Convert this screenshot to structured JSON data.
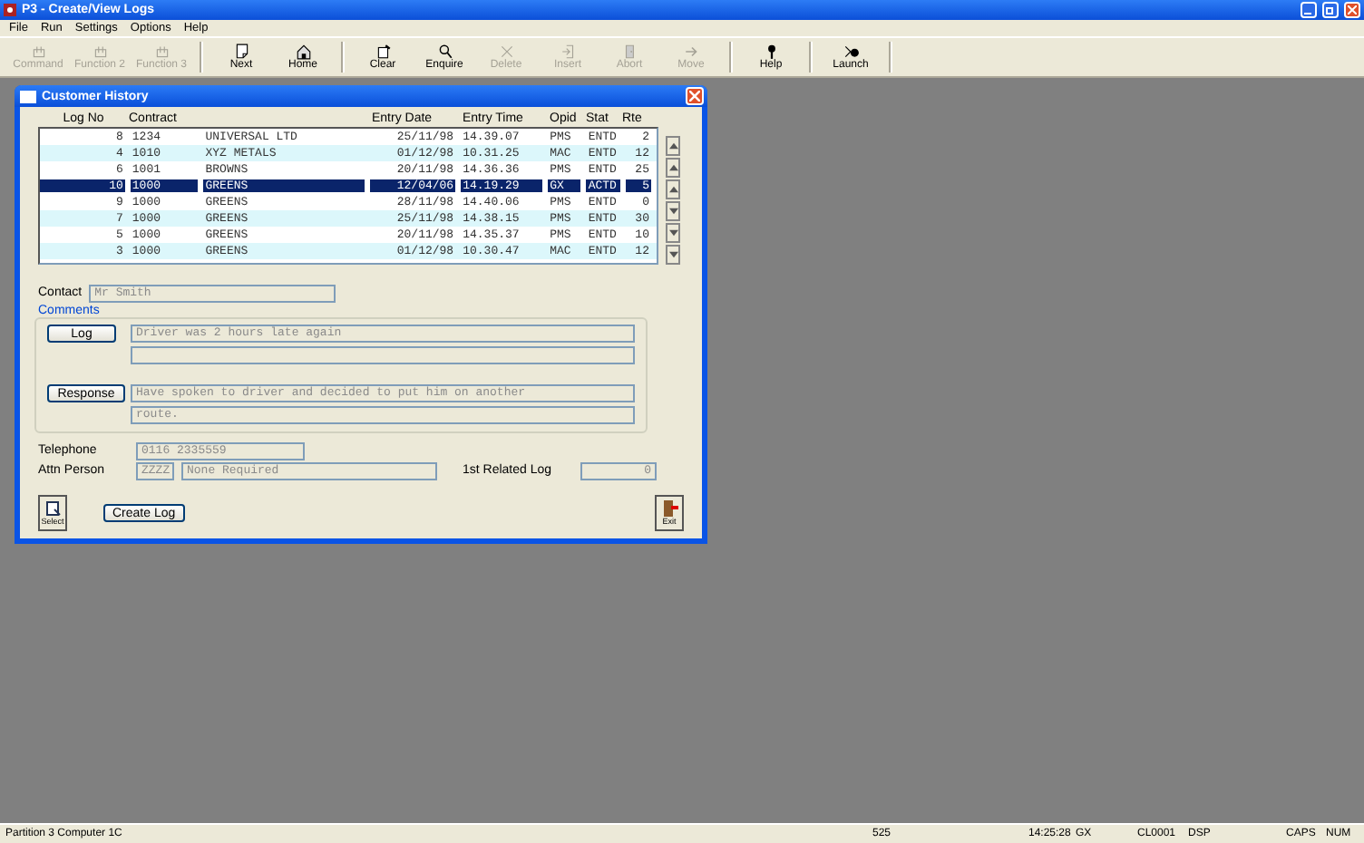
{
  "window": {
    "title": "P3 - Create/View Logs"
  },
  "menu": [
    "File",
    "Run",
    "Settings",
    "Options",
    "Help"
  ],
  "toolbar": [
    {
      "label": "Command",
      "disabled": true
    },
    {
      "label": "Function 2",
      "disabled": true
    },
    {
      "label": "Function 3",
      "disabled": true
    },
    {
      "label": "Next",
      "disabled": false
    },
    {
      "label": "Home",
      "disabled": false
    },
    {
      "label": "Clear",
      "disabled": false
    },
    {
      "label": "Enquire",
      "disabled": false
    },
    {
      "label": "Delete",
      "disabled": true
    },
    {
      "label": "Insert",
      "disabled": true
    },
    {
      "label": "Abort",
      "disabled": true
    },
    {
      "label": "Move",
      "disabled": true
    },
    {
      "label": "Help",
      "disabled": false
    },
    {
      "label": "Launch",
      "disabled": false
    }
  ],
  "dialog": {
    "title": "Customer History",
    "table": {
      "columns": [
        "Log No",
        "Contract",
        null,
        "Entry Date",
        "Entry Time",
        "Opid",
        "Stat",
        "Rte"
      ],
      "rows": [
        {
          "cells": [
            "8",
            "1234",
            "UNIVERSAL LTD",
            "25/11/98",
            "14.39.07",
            "PMS",
            "ENTD",
            "2"
          ],
          "selected": false
        },
        {
          "cells": [
            "4",
            "1010",
            "XYZ METALS",
            "01/12/98",
            "10.31.25",
            "MAC",
            "ENTD",
            "12"
          ],
          "selected": false
        },
        {
          "cells": [
            "6",
            "1001",
            "BROWNS",
            "20/11/98",
            "14.36.36",
            "PMS",
            "ENTD",
            "25"
          ],
          "selected": false
        },
        {
          "cells": [
            "10",
            "1000",
            "GREENS",
            "12/04/06",
            "14.19.29",
            "GX",
            "ACTD",
            "5"
          ],
          "selected": true
        },
        {
          "cells": [
            "9",
            "1000",
            "GREENS",
            "28/11/98",
            "14.40.06",
            "PMS",
            "ENTD",
            "0"
          ],
          "selected": false
        },
        {
          "cells": [
            "7",
            "1000",
            "GREENS",
            "25/11/98",
            "14.38.15",
            "PMS",
            "ENTD",
            "30"
          ],
          "selected": false
        },
        {
          "cells": [
            "5",
            "1000",
            "GREENS",
            "20/11/98",
            "14.35.37",
            "PMS",
            "ENTD",
            "10"
          ],
          "selected": false
        },
        {
          "cells": [
            "3",
            "1000",
            "GREENS",
            "01/12/98",
            "10.30.47",
            "MAC",
            "ENTD",
            "12"
          ],
          "selected": false
        }
      ]
    },
    "contact": {
      "label": "Contact",
      "value": "Mr Smith"
    },
    "comments": {
      "title": "Comments",
      "log_button": "Log",
      "log_lines": [
        "Driver was 2 hours late again"
      ],
      "response_button": "Response",
      "response_lines": [
        "Have spoken to driver and decided to put him on another",
        "route."
      ]
    },
    "telephone": {
      "label": "Telephone",
      "value": "0116 2335559"
    },
    "attn_person": {
      "label": "Attn Person",
      "code": "ZZZZ",
      "value": "None Required"
    },
    "related_log": {
      "label": "1st Related Log",
      "value": "0"
    },
    "select_button": "Select",
    "create_button": "Create Log",
    "exit_button": "Exit"
  },
  "status_bar": [
    "Partition 3 Computer 1C",
    "525",
    "14:25:28",
    "GX",
    "CL0001",
    "DSP",
    "CAPS",
    "NUM"
  ]
}
